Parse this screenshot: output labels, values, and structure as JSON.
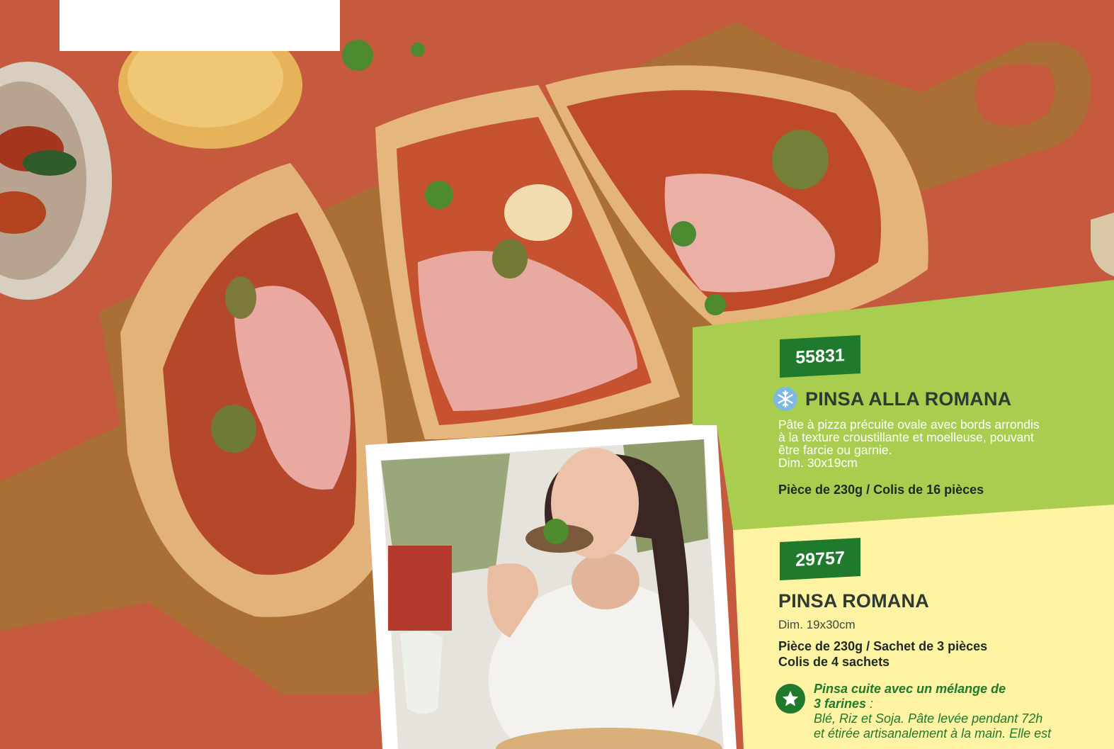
{
  "products": [
    {
      "code": "55831",
      "title": "PINSA ALLA ROMANA",
      "frozen_icon": "snowflake-icon",
      "description_lines": [
        "Pâte à pizza précuite ovale avec bords arrondis",
        "à la texture croustillante et moelleuse, pouvant",
        "être farcie ou garnie."
      ],
      "dimensions": "Dim. 30x19cm",
      "packaging": "Pièce de 230g / Colis de 16 pièces"
    },
    {
      "code": "29757",
      "title": "PINSA ROMANA",
      "dimensions": "Dim. 19x30cm",
      "packaging_lines": [
        "Pièce de 230g / Sachet de 3 pièces",
        "Colis de 4 sachets"
      ],
      "feature_icon": "star-icon",
      "feature_title_lines": [
        "Pinsa cuite avec un mélange de",
        "3 farines"
      ],
      "feature_title_suffix": " :",
      "feature_text_lines": [
        "Blé, Riz et Soja. Pâte levée pendant 72h",
        "et étirée artisanalement à la main. Elle est"
      ]
    }
  ],
  "colors": {
    "background": "#c65a3e",
    "green_panel": "#a9cd4f",
    "yellow_panel": "#fdf3a3",
    "badge": "#1f7a2e",
    "text_dark": "#2f3a33"
  }
}
